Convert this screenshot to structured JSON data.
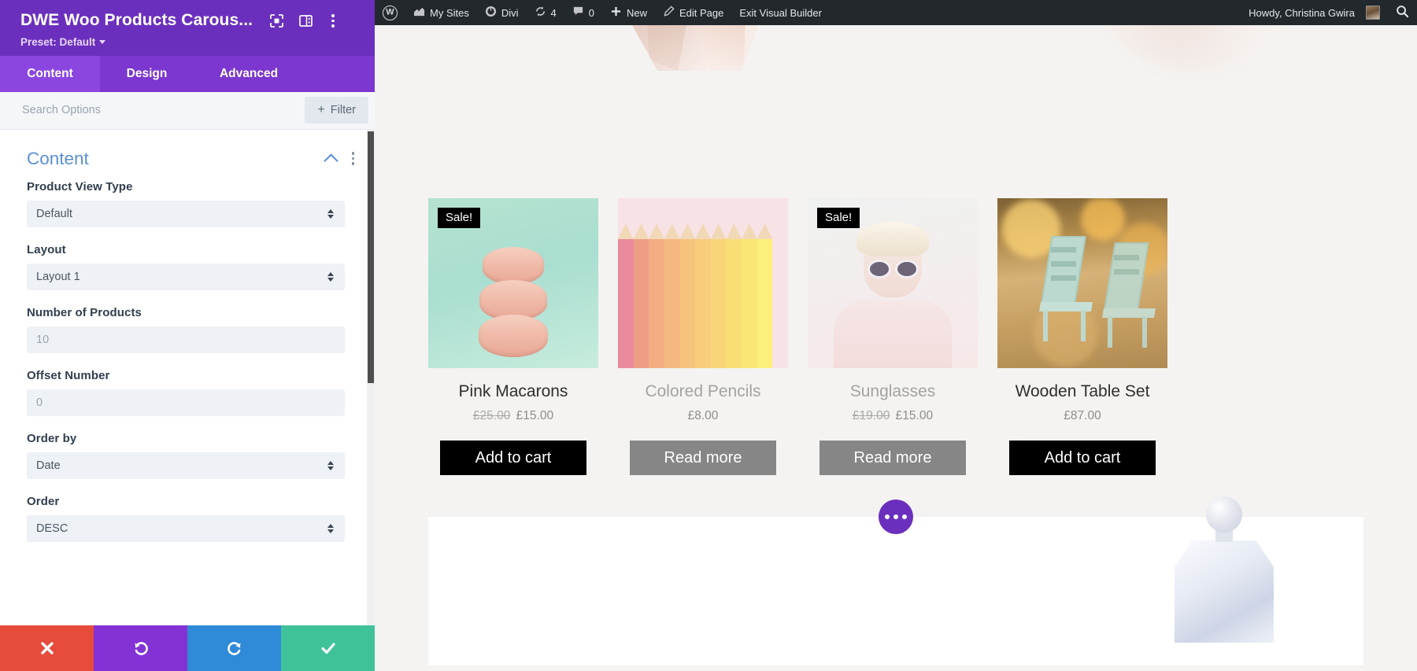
{
  "panel": {
    "title": "DWE Woo Products Carous...",
    "preset_label": "Preset: Default",
    "head_icons": [
      "target-icon",
      "layout-icon",
      "kebab-menu-icon"
    ],
    "tabs": [
      {
        "label": "Content",
        "active": true
      },
      {
        "label": "Design",
        "active": false
      },
      {
        "label": "Advanced",
        "active": false
      }
    ],
    "search": {
      "placeholder": "Search Options",
      "value": ""
    },
    "filter_label": "Filter",
    "section": {
      "title": "Content"
    },
    "fields": [
      {
        "label": "Product View Type",
        "value": "Default",
        "type": "select"
      },
      {
        "label": "Layout",
        "value": "Layout 1",
        "type": "select"
      },
      {
        "label": "Number of Products",
        "value": "10",
        "type": "number"
      },
      {
        "label": "Offset Number",
        "value": "0",
        "type": "number"
      },
      {
        "label": "Order by",
        "value": "Date",
        "type": "select"
      },
      {
        "label": "Order",
        "value": "DESC",
        "type": "select"
      }
    ],
    "actions": [
      {
        "name": "cancel",
        "icon": "close-icon",
        "color": "#e64b3c"
      },
      {
        "name": "undo",
        "icon": "undo-icon",
        "color": "#8332d6"
      },
      {
        "name": "redo",
        "icon": "redo-icon",
        "color": "#2f8ad8"
      },
      {
        "name": "save",
        "icon": "check-icon",
        "color": "#3fc29a"
      }
    ]
  },
  "adminbar": {
    "items": [
      {
        "label": "",
        "icon": "wordpress-logo-icon"
      },
      {
        "label": "My Sites",
        "icon": "sites-icon"
      },
      {
        "label": "Divi",
        "icon": "divi-icon"
      },
      {
        "label": "4",
        "icon": "updates-icon"
      },
      {
        "label": "0",
        "icon": "comments-icon"
      },
      {
        "label": "New",
        "icon": "plus-icon"
      },
      {
        "label": "Edit Page",
        "icon": "pencil-icon"
      },
      {
        "label": "Exit Visual Builder",
        "icon": ""
      }
    ],
    "greeting": "Howdy, Christina Gwira",
    "search_icon": "search-icon"
  },
  "canvas": {
    "products": [
      {
        "name": "Pink Macarons",
        "sale_badge": "Sale!",
        "on_sale": true,
        "old_price": "£25.00",
        "price": "£15.00",
        "button": "Add to cart",
        "button_style": "black",
        "title_style": "dark",
        "image": "pink-macarons-image"
      },
      {
        "name": "Colored Pencils",
        "sale_badge": "",
        "on_sale": false,
        "old_price": "",
        "price": "£8.00",
        "button": "Read more",
        "button_style": "grey",
        "title_style": "grey",
        "image": "colored-pencils-image"
      },
      {
        "name": "Sunglasses",
        "sale_badge": "Sale!",
        "on_sale": true,
        "old_price": "£19.00",
        "price": "£15.00",
        "button": "Read more",
        "button_style": "grey",
        "title_style": "grey",
        "image": "sunglasses-image"
      },
      {
        "name": "Wooden Table Set",
        "sale_badge": "",
        "on_sale": false,
        "old_price": "",
        "price": "£87.00",
        "button": "Add to cart",
        "button_style": "black",
        "title_style": "dark",
        "image": "wooden-table-set-image"
      }
    ],
    "add_section_icon": "three-dots-icon"
  },
  "colors": {
    "panel_header": "#6b2fbd",
    "panel_tabs": "#7b37cf",
    "tab_active": "#8b46e0",
    "section_title": "#5a8fd6",
    "adminbar": "#23282d",
    "canvas_bg": "#f4f3f1",
    "sale_badge": "#000000",
    "btn_black": "#000000",
    "btn_grey": "#868686"
  }
}
